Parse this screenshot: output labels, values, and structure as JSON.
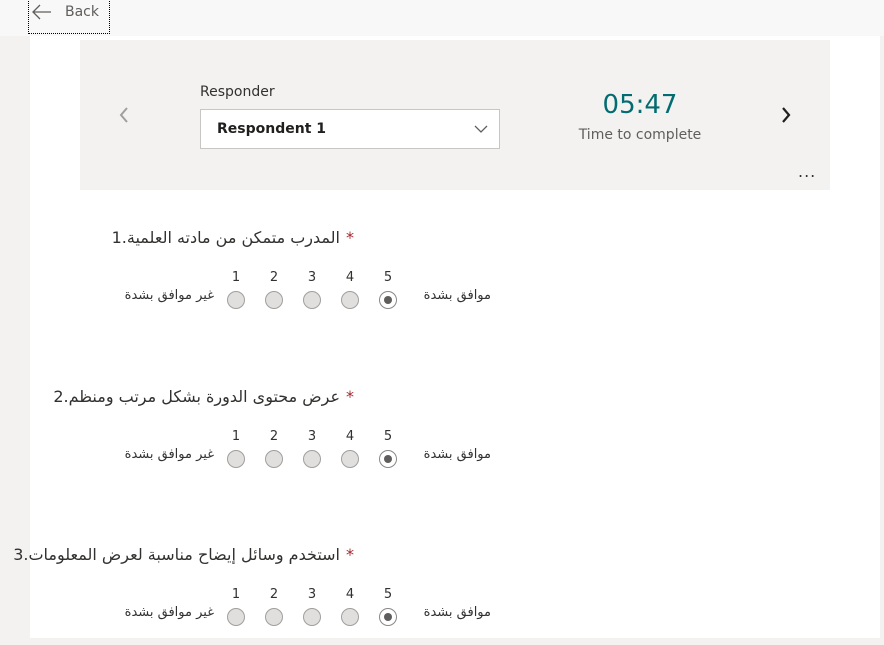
{
  "topbar": {
    "back_label": "Back"
  },
  "header": {
    "responder_label": "Responder",
    "responder_value": "Respondent 1",
    "timer": "05:47",
    "timer_label": "Time to complete",
    "more_label": "..."
  },
  "scale": {
    "numbers": [
      "1",
      "2",
      "3",
      "4",
      "5"
    ],
    "low_label": "غير موافق بشدة",
    "high_label": "موافق بشدة"
  },
  "questions": [
    {
      "number": "1.",
      "text": "المدرب متمكن من مادته العلمية",
      "required_mark": "*",
      "selected": 5
    },
    {
      "number": "2.",
      "text": "عرض محتوى الدورة بشكل مرتب ومنظم",
      "required_mark": "*",
      "selected": 5
    },
    {
      "number": "3.",
      "text": "استخدم وسائل إيضاح مناسبة لعرض المعلومات",
      "required_mark": "*",
      "selected": 5
    }
  ],
  "icons": {
    "back": "arrow-left-icon",
    "prev": "chevron-left-icon",
    "next": "chevron-right-icon",
    "dropdown": "chevron-down-icon"
  }
}
